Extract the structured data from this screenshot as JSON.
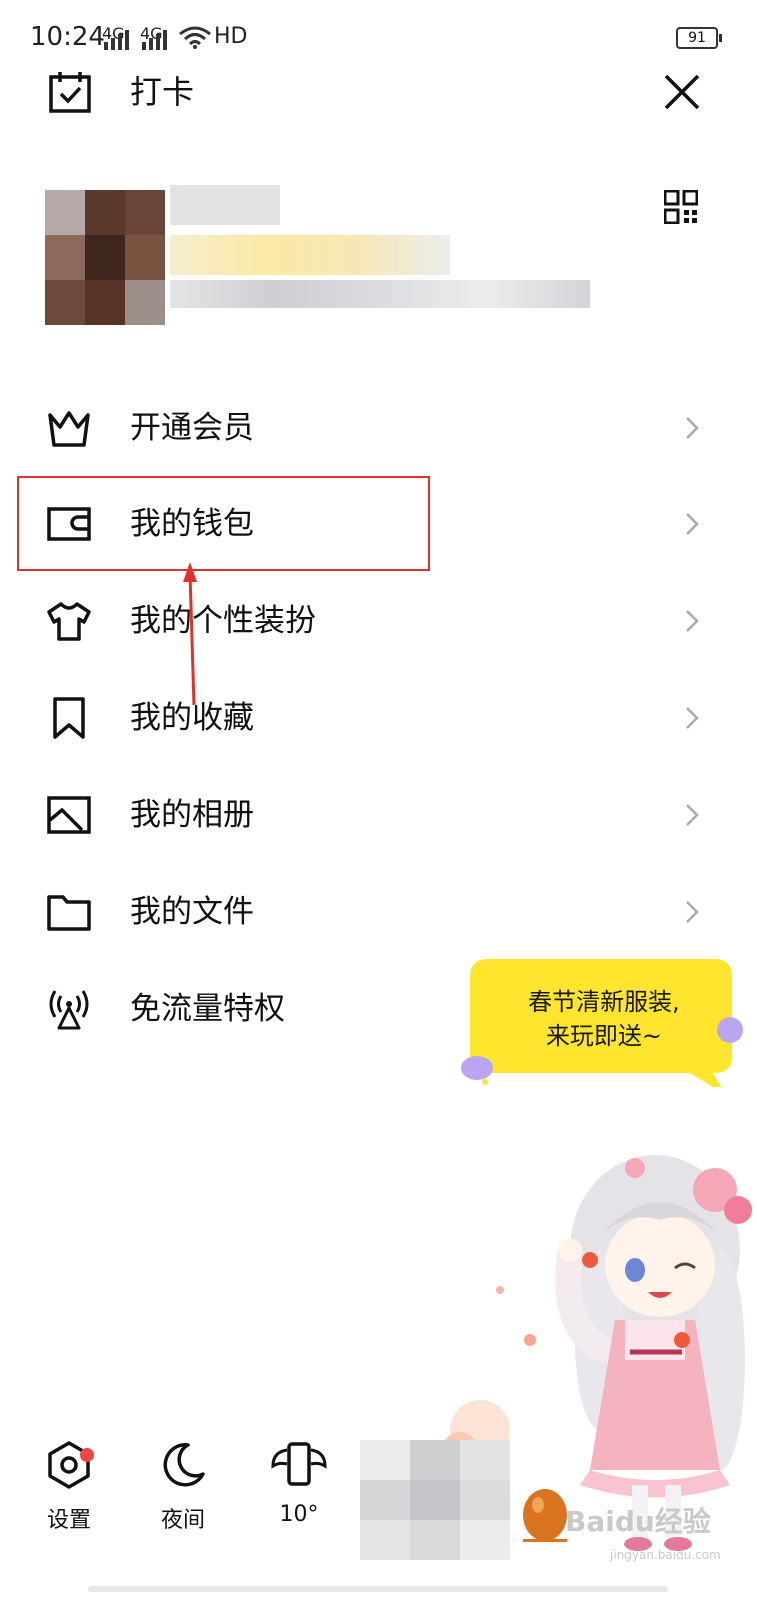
{
  "status_bar": {
    "time": "10:24",
    "network_1": "4G",
    "network_2": "4G",
    "hd": "HD",
    "battery": "91"
  },
  "header": {
    "checkin_label": "打卡"
  },
  "menu": {
    "items": [
      {
        "label": "开通会员",
        "icon": "crown-icon"
      },
      {
        "label": "我的钱包",
        "icon": "wallet-icon"
      },
      {
        "label": "我的个性装扮",
        "icon": "tshirt-icon"
      },
      {
        "label": "我的收藏",
        "icon": "bookmark-icon"
      },
      {
        "label": "我的相册",
        "icon": "photo-album-icon"
      },
      {
        "label": "我的文件",
        "icon": "folder-icon"
      },
      {
        "label": "免流量特权",
        "icon": "signal-tower-icon"
      }
    ]
  },
  "promo": {
    "line1": "春节清新服装,",
    "line2": "来玩即送~"
  },
  "bottom_bar": {
    "settings_label": "设置",
    "night_label": "夜间",
    "third_label": "10°"
  },
  "watermark": {
    "text": "Baidu经验",
    "sub": "jingyan.baidu.com"
  },
  "colors": {
    "highlight": "#e0312d",
    "promo_yellow": "#ffe52e",
    "accent_dot": "#f0473c"
  }
}
